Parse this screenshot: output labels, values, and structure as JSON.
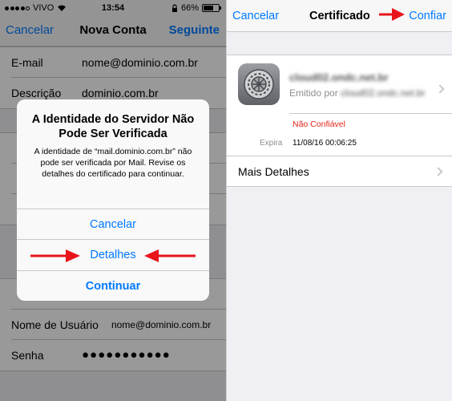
{
  "status_bar": {
    "carrier": "VIVO",
    "time": "13:54",
    "battery": "66%",
    "battery_level": 0.66,
    "signal_bars_filled": 4,
    "signal_bars_total": 5
  },
  "left_nav": {
    "left_label": "Cancelar",
    "title": "Nova Conta",
    "right_label": "Seguinte"
  },
  "form": {
    "email_label": "E-mail",
    "email_value": "nome@dominio.com.br",
    "description_label": "Descrição",
    "description_value": "dominio.com.br",
    "username_label": "Nome de Usuário",
    "username_value": "nome@dominio.com.br",
    "password_label": "Senha",
    "password_value": "●●●●●●●●●●●"
  },
  "alert": {
    "title": "A Identidade do Servidor Não Pode Ser Verificada",
    "message": "A identidade de “mail.dominio.com.br” não pode ser verificada por Mail. Revise os detalhes do certificado para continuar.",
    "buttons": [
      "Cancelar",
      "Detalhes",
      "Continuar"
    ]
  },
  "right_nav": {
    "left_label": "Cancelar",
    "title": "Certificado",
    "right_label": "Confiar"
  },
  "certificate": {
    "name": "cloud02.ondc.net.br",
    "issuer_prefix": "Emitido por",
    "issuer_name": "cloud02.ondc.net.br",
    "status": "Não Confiável",
    "expires_label": "Expira",
    "expires_value": "11/08/16 00:06:25",
    "more_details": "Mais Detalhes"
  },
  "colors": {
    "accent": "#007aff",
    "warning": "#e2231a",
    "annotation_arrow": "#e8141c"
  },
  "icons": [
    "wifi-icon",
    "battery-icon",
    "settings-gear-icon",
    "chevron-right-icon",
    "red-arrow-icon"
  ]
}
